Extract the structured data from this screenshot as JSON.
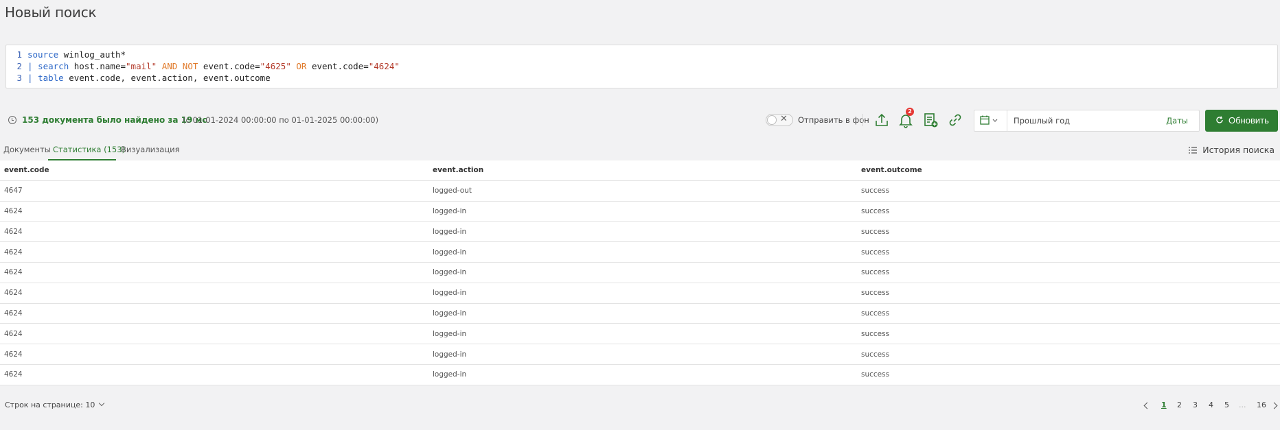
{
  "page": {
    "title": "Новый поиск"
  },
  "query": {
    "lines": [
      {
        "num": "1"
      },
      {
        "num": "2"
      },
      {
        "num": "3"
      }
    ],
    "l1": {
      "kw": "source",
      "rest": " winlog_auth*"
    },
    "l2": {
      "pipe": "| ",
      "kw": "search",
      "a": " host.name=",
      "s1": "\"mail\"",
      "op1": " AND NOT",
      "b": " event.code=",
      "s2": "\"4625\"",
      "op2": " OR",
      "c": " event.code=",
      "s3": "\"4624\""
    },
    "l3": {
      "pipe": "| ",
      "kw": "table",
      "rest": " event.code, event.action, event.outcome"
    }
  },
  "status": {
    "found": "153 документа было найдено за 19 мс",
    "range": "(с 01-01-2024 00:00:00 по 01-01-2025 00:00:00)",
    "background_label": "Отправить в фон",
    "toggle_glyph": "✕",
    "notifications_count": "2",
    "date_value": "Прошлый год",
    "date_mode": "Даты",
    "refresh_label": "Обновить"
  },
  "tabs": [
    {
      "label": "Документы"
    },
    {
      "label": "Статистика (153)"
    },
    {
      "label": "Визуализация"
    }
  ],
  "history_label": "История поиска",
  "table": {
    "headers": [
      "event.code",
      "event.action",
      "event.outcome"
    ],
    "rows": [
      [
        "4647",
        "logged-out",
        "success"
      ],
      [
        "4624",
        "logged-in",
        "success"
      ],
      [
        "4624",
        "logged-in",
        "success"
      ],
      [
        "4624",
        "logged-in",
        "success"
      ],
      [
        "4624",
        "logged-in",
        "success"
      ],
      [
        "4624",
        "logged-in",
        "success"
      ],
      [
        "4624",
        "logged-in",
        "success"
      ],
      [
        "4624",
        "logged-in",
        "success"
      ],
      [
        "4624",
        "logged-in",
        "success"
      ],
      [
        "4624",
        "logged-in",
        "success"
      ]
    ]
  },
  "pagination": {
    "rows_per_page": "Строк на странице: 10",
    "pages": [
      "1",
      "2",
      "3",
      "4",
      "5",
      "...",
      "16"
    ],
    "active_page": "1"
  },
  "colors": {
    "accent": "#2e7d32",
    "badge": "#e53935"
  }
}
